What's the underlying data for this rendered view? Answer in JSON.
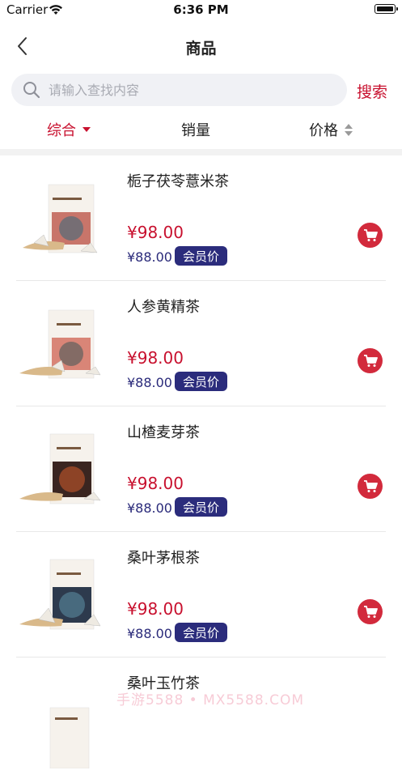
{
  "status_bar": {
    "carrier": "Carrier",
    "time": "6:36 PM"
  },
  "nav": {
    "title": "商品"
  },
  "search": {
    "placeholder": "请输入查找内容",
    "button_label": "搜索"
  },
  "sort": {
    "comprehensive": "综合",
    "sales": "销量",
    "price": "价格",
    "active_color": "#c8102e"
  },
  "products": [
    {
      "name": "栀子茯苓薏米茶",
      "price": "¥98.00",
      "member_price": "¥88.00",
      "badge": "会员价",
      "box_color": "#c8756a",
      "box_text": "栀子茯苓薏米茶"
    },
    {
      "name": "人参黄精茶",
      "price": "¥98.00",
      "member_price": "¥88.00",
      "badge": "会员价",
      "box_color": "#d98577",
      "box_text": "人参黄精茶"
    },
    {
      "name": "山楂麦芽茶",
      "price": "¥98.00",
      "member_price": "¥88.00",
      "badge": "会员价",
      "box_color": "#3a2520",
      "box_text": "山楂麦芽茶"
    },
    {
      "name": "桑叶茅根茶",
      "price": "¥98.00",
      "member_price": "¥88.00",
      "badge": "会员价",
      "box_color": "#2d3a4d",
      "box_text": "桑叶茅根茶"
    },
    {
      "name": "桑叶玉竹茶",
      "price": "",
      "member_price": "",
      "badge": "",
      "box_color": "#e8e2da",
      "box_text": "桑叶玉竹茶"
    }
  ],
  "watermark": "手游5588 • MX5588.COM",
  "colors": {
    "accent": "#c8102e",
    "member_badge": "#2b2c7c",
    "cart": "#d22a3c"
  }
}
